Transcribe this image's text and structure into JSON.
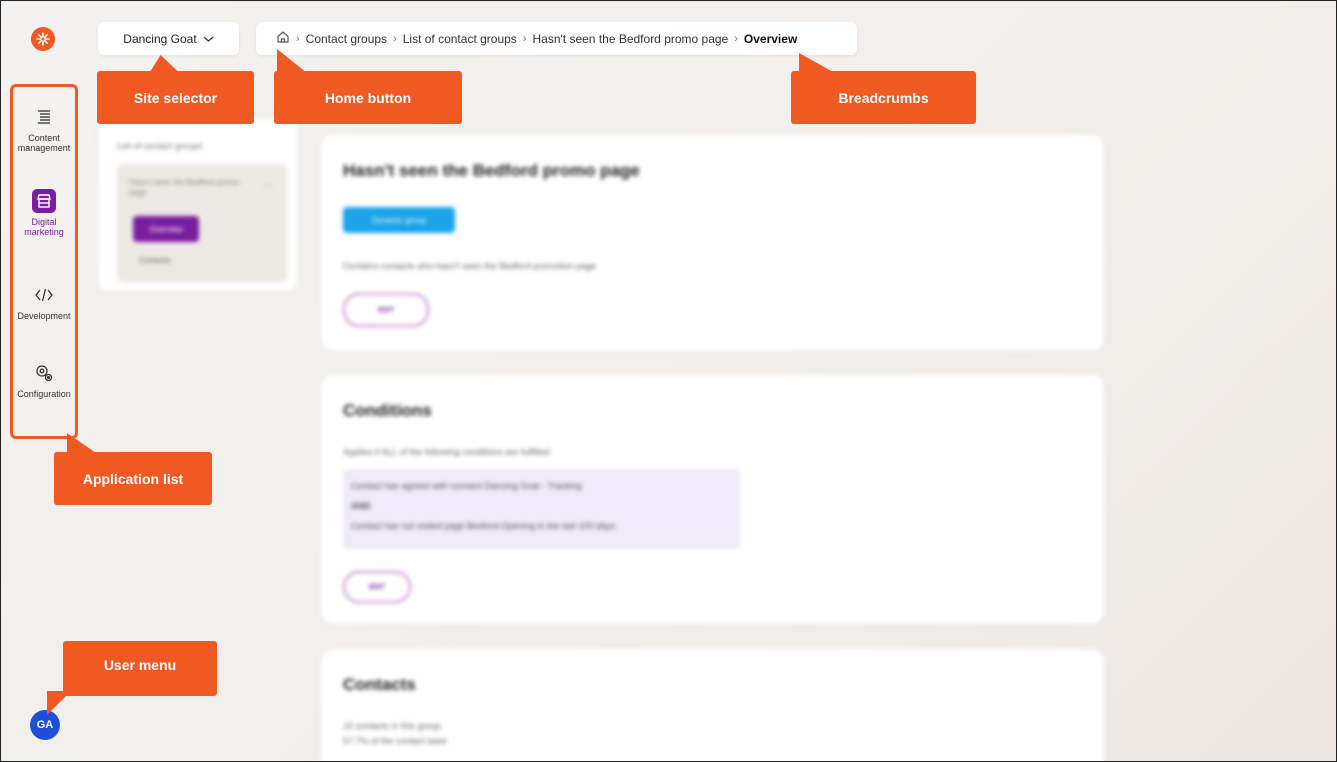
{
  "rail": {
    "apps": [
      {
        "label": "Content management",
        "icon": "content-list-icon"
      },
      {
        "label": "Digital marketing",
        "icon": "storefront-icon"
      },
      {
        "label": "Development",
        "icon": "code-brackets-icon"
      },
      {
        "label": "Configuration",
        "icon": "gears-icon"
      }
    ],
    "user_initials": "GA",
    "active_color": "#7a1ea1",
    "brand_color": "#f05a22"
  },
  "topbar": {
    "site_selector": "Dancing Goat",
    "breadcrumbs": [
      "Contact groups",
      "List of contact groups",
      "Hasn't seen the Bedford promo page",
      "Overview"
    ]
  },
  "nav_panel": {
    "header": "List of contact groups",
    "group_name": "Hasn't seen the Bedford promo page",
    "items": [
      "Overview",
      "Contacts"
    ]
  },
  "overview_card": {
    "title": "Hasn't seen the Bedford promo page",
    "badge": "Dynamic group",
    "description": "Contains contacts who hasn't seen the Bedford promotion page",
    "edit_label": "EDIT"
  },
  "conditions_card": {
    "title": "Conditions",
    "intro": "Applies if ALL of the following conditions are fulfilled:",
    "lines": [
      "Contact has agreed with consent Dancing Goat - Tracking",
      "AND",
      "Contact has not visited page Bedford Opening in the last 100 days"
    ],
    "edit_label": "EDIT"
  },
  "contacts_card": {
    "title": "Contacts",
    "line1": "15 contacts in this group",
    "line2": "57.7% of the contact base"
  },
  "callouts": {
    "site_selector": "Site selector",
    "home_button": "Home button",
    "breadcrumbs": "Breadcrumbs",
    "application_list": "Application list",
    "user_menu": "User menu"
  }
}
